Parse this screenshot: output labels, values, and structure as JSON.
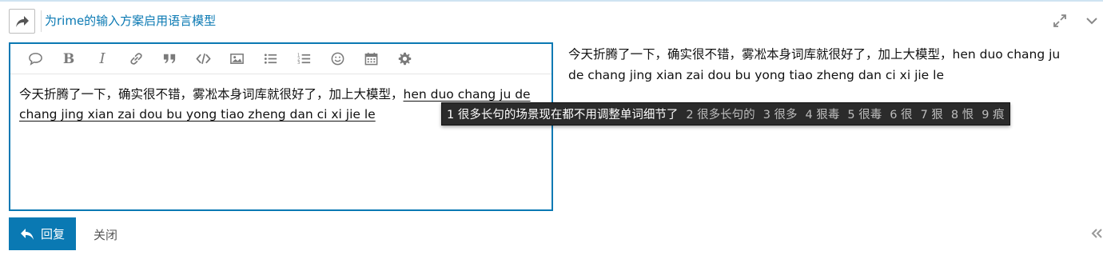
{
  "header": {
    "topic_title": "为rime的输入方案启用语言模型"
  },
  "editor": {
    "committed_text": "今天折腾了一下，确实很不错，雾凇本身词库就很好了，加上大模型，",
    "composing_text": "hen duo chang ju de chang jing xian zai dou bu yong tiao zheng dan ci xi jie le",
    "toolbar": [
      {
        "name": "quote-reply-icon"
      },
      {
        "name": "bold-icon",
        "glyph": "B"
      },
      {
        "name": "italic-icon",
        "glyph": "I"
      },
      {
        "name": "link-icon"
      },
      {
        "name": "blockquote-icon"
      },
      {
        "name": "code-icon"
      },
      {
        "name": "image-icon"
      },
      {
        "name": "bullet-list-icon"
      },
      {
        "name": "numbered-list-icon"
      },
      {
        "name": "emoji-icon"
      },
      {
        "name": "calendar-icon"
      },
      {
        "name": "gear-icon"
      }
    ]
  },
  "ime": {
    "candidates": [
      "1 很多长句的场景现在都不用调整单词细节了",
      "2 很多长句的",
      "3 很多",
      "4 狠毒",
      "5 很毒",
      "6 很",
      "7 狠",
      "8 恨",
      "9 痕"
    ]
  },
  "preview": {
    "text": "今天折腾了一下，确实很不错，雾凇本身词库就很好了，加上大模型，hen duo chang ju de chang jing xian zai dou bu yong tiao zheng dan ci xi jie le"
  },
  "footer": {
    "reply_label": "回复",
    "close_label": "关闭"
  },
  "colors": {
    "accent": "#0a79b3",
    "popup_bg": "#2b2b2b"
  }
}
